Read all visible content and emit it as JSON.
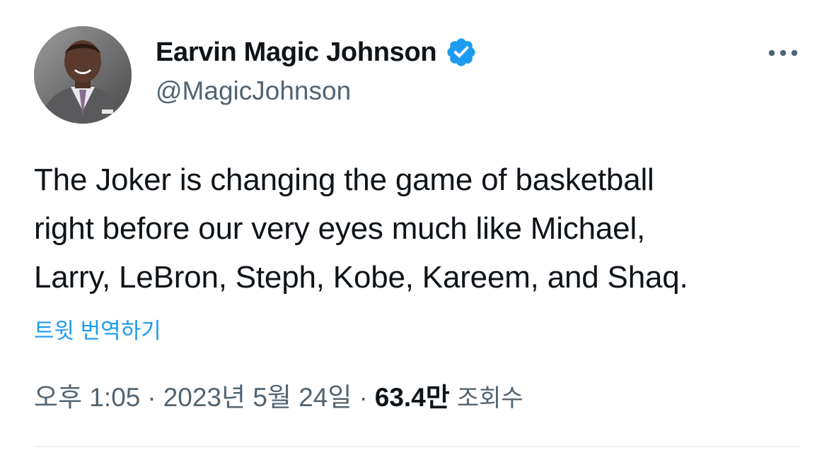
{
  "author": {
    "display_name": "Earvin Magic Johnson",
    "handle": "@MagicJohnson",
    "verified": true,
    "verified_color": "#1d9bf0",
    "avatar_icon": "profile-photo"
  },
  "more_icon": "more-horizontal-icon",
  "tweet": {
    "lines": [
      "The Joker is changing the game of basketball",
      "right before our very eyes much like Michael,",
      "Larry, LeBron, Steph, Kobe, Kareem, and Shaq."
    ],
    "translate_label": "트윗 번역하기"
  },
  "meta": {
    "time": "오후 1:05",
    "separator": "·",
    "date": "2023년 5월 24일",
    "views_count": "63.4만",
    "views_label": "조회수"
  },
  "colors": {
    "text_primary": "#0f1419",
    "text_secondary": "#536471",
    "link": "#1d9bf0",
    "divider": "#eff3f4"
  }
}
